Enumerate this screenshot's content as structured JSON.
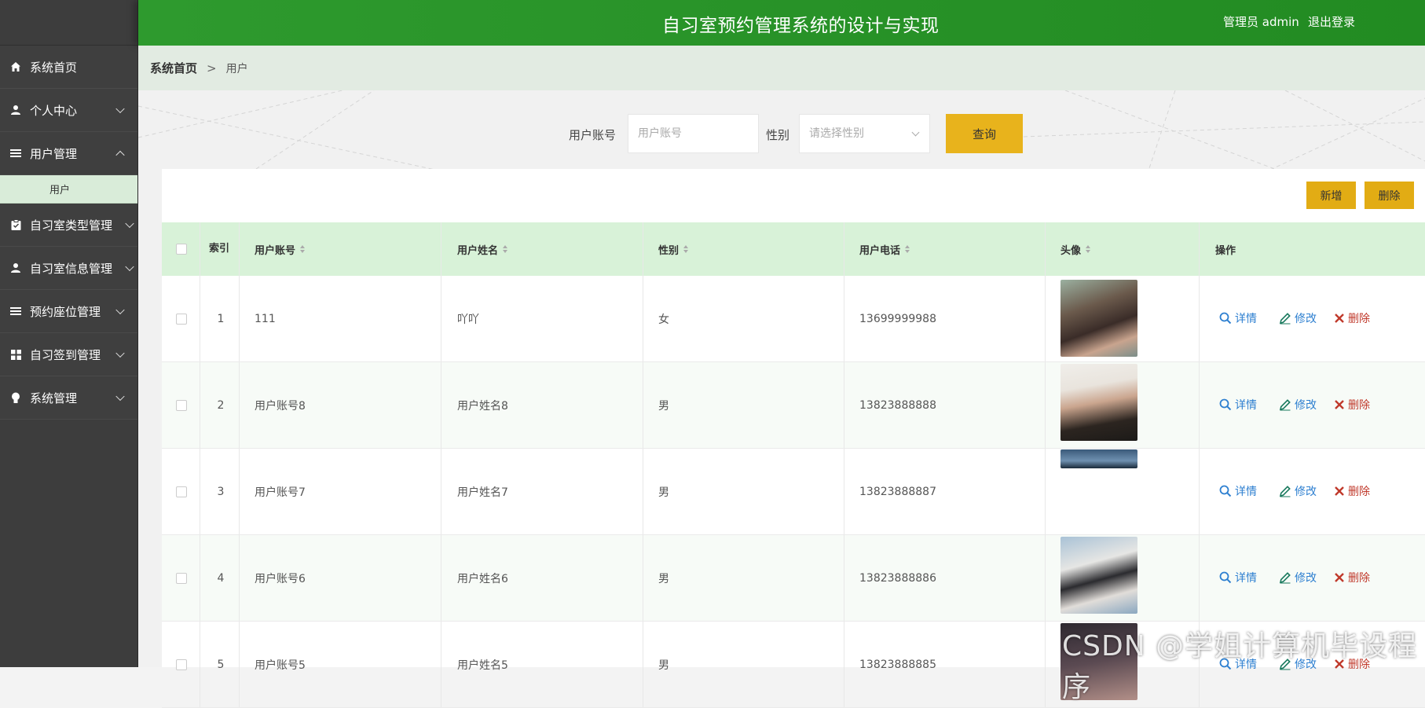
{
  "app": {
    "title": "自习室预约管理系统的设计与实现",
    "user_label": "管理员 admin",
    "logout_label": "退出登录"
  },
  "sidebar": {
    "items": [
      {
        "label": "系统首页",
        "icon": "home-icon"
      },
      {
        "label": "个人中心",
        "icon": "user-icon"
      },
      {
        "label": "用户管理",
        "icon": "list-icon",
        "expanded": true
      },
      {
        "label": "自习室类型管理",
        "icon": "clipboard-icon"
      },
      {
        "label": "自习室信息管理",
        "icon": "user-icon"
      },
      {
        "label": "预约座位管理",
        "icon": "list-icon"
      },
      {
        "label": "自习签到管理",
        "icon": "grid-icon"
      },
      {
        "label": "系统管理",
        "icon": "bulb-icon"
      }
    ],
    "sub_item": "用户"
  },
  "breadcrumb": {
    "home": "系统首页",
    "separator": ">",
    "current": "用户"
  },
  "search": {
    "account_label": "用户账号",
    "account_placeholder": "用户账号",
    "gender_label": "性别",
    "gender_placeholder": "请选择性别",
    "query_button": "查询"
  },
  "toolbar": {
    "add_label": "新增",
    "delete_label": "删除"
  },
  "table": {
    "headers": {
      "index": "索引",
      "account": "用户账号",
      "name": "用户姓名",
      "gender": "性别",
      "phone": "用户电话",
      "avatar": "头像",
      "actions": "操作"
    },
    "actions": {
      "detail": "详情",
      "edit": "修改",
      "delete": "删除"
    },
    "rows": [
      {
        "index": "1",
        "account": "111",
        "name": "吖吖",
        "gender": "女",
        "phone": "13699999988",
        "avatar": "photo"
      },
      {
        "index": "2",
        "account": "用户账号8",
        "name": "用户姓名8",
        "gender": "男",
        "phone": "13823888888",
        "avatar": "photo"
      },
      {
        "index": "3",
        "account": "用户账号7",
        "name": "用户姓名7",
        "gender": "男",
        "phone": "13823888887",
        "avatar": "strip"
      },
      {
        "index": "4",
        "account": "用户账号6",
        "name": "用户姓名6",
        "gender": "男",
        "phone": "13823888886",
        "avatar": "photo"
      },
      {
        "index": "5",
        "account": "用户账号5",
        "name": "用户姓名5",
        "gender": "男",
        "phone": "13823888885",
        "avatar": "photo"
      }
    ]
  },
  "watermark": "CSDN @学姐计算机毕设程序",
  "colors": {
    "header": "#2e9a2e",
    "accent": "#e8b31c",
    "sidebar": "#3d3d3d",
    "table_head": "#d8f2d8"
  }
}
